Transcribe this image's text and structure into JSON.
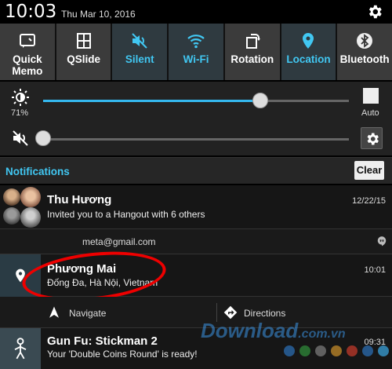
{
  "status_bar": {
    "time": "10:03",
    "date": "Thu Mar 10, 2016"
  },
  "tiles": [
    {
      "label": "Quick\nMemo",
      "icon": "quick-memo-icon",
      "active": false
    },
    {
      "label": "QSlide",
      "icon": "qslide-icon",
      "active": false
    },
    {
      "label": "Silent",
      "icon": "silent-icon",
      "active": true
    },
    {
      "label": "Wi-Fi",
      "icon": "wifi-icon",
      "active": true
    },
    {
      "label": "Rotation",
      "icon": "rotation-icon",
      "active": false
    },
    {
      "label": "Location",
      "icon": "location-icon",
      "active": true
    },
    {
      "label": "Bluetooth",
      "icon": "bluetooth-icon",
      "active": false
    }
  ],
  "brightness": {
    "percent_label": "71%",
    "level": 0.71,
    "auto_label": "Auto"
  },
  "volume": {
    "level": 0.0
  },
  "notifications": {
    "title": "Notifications",
    "clear_label": "Clear",
    "items": [
      {
        "title": "Thu Hương",
        "subtitle": "Invited you to a Hangout with 6 others",
        "time": "12/22/15",
        "account": "meta@gmail.com"
      },
      {
        "title": "Phương Mai",
        "subtitle": "Đống Đa, Hà Nội, Vietnam",
        "time": "10:01",
        "actions": [
          "Navigate",
          "Directions"
        ]
      },
      {
        "title": "Gun Fu: Stickman 2",
        "subtitle": "Your 'Double Coins Round' is ready!",
        "time": "09:31"
      }
    ]
  },
  "watermark": {
    "brand": "Download",
    "tld": ".com.vn"
  },
  "colors": {
    "accent": "#41c7f2",
    "slider": "#35b8ef",
    "highlight": "#e00000"
  },
  "watermark_dots": [
    "#2b6cb0",
    "#2f8a3a",
    "#7a7a7a",
    "#c28a2a",
    "#c0392b",
    "#2b6cb0",
    "#3aa0d8"
  ]
}
